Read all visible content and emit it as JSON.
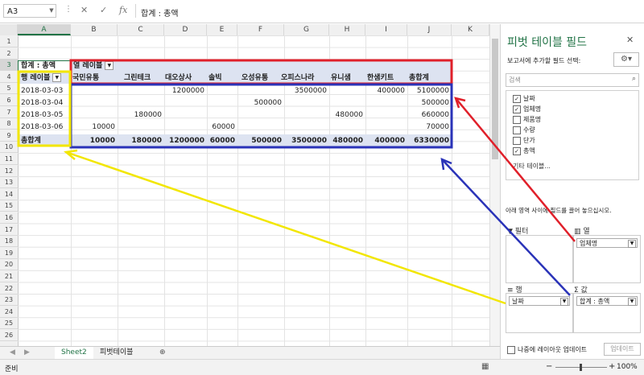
{
  "formula_bar": {
    "name_box": "A3",
    "formula": "합계 : 총액"
  },
  "columns": [
    "A",
    "B",
    "C",
    "D",
    "E",
    "F",
    "G",
    "H",
    "I",
    "J",
    "K"
  ],
  "rows": [
    "1",
    "2",
    "3",
    "4",
    "5",
    "6",
    "7",
    "8",
    "9",
    "10",
    "11",
    "12",
    "13",
    "14",
    "15",
    "16",
    "17",
    "18",
    "19",
    "20",
    "21",
    "22",
    "23",
    "24",
    "25",
    "26"
  ],
  "pivot": {
    "corner": "합계 : 총액",
    "col_label": "열 레이블",
    "row_label": "행 레이블",
    "headers": [
      "국민유통",
      "그린테크",
      "대오상사",
      "솔빅",
      "오성유통",
      "오피스나라",
      "유니샘",
      "한샘키트",
      "총합계"
    ],
    "dates": [
      "2018-03-03",
      "2018-03-04",
      "2018-03-05",
      "2018-03-06"
    ],
    "values": [
      [
        "",
        "",
        "1200000",
        "",
        "",
        "3500000",
        "",
        "400000",
        "5100000"
      ],
      [
        "",
        "",
        "",
        "",
        "500000",
        "",
        "",
        "",
        "500000"
      ],
      [
        "",
        "180000",
        "",
        "",
        "",
        "",
        "480000",
        "",
        "660000"
      ],
      [
        "10000",
        "",
        "",
        "60000",
        "",
        "",
        "",
        "",
        "70000"
      ]
    ],
    "total_label": "총합계",
    "totals": [
      "10000",
      "180000",
      "1200000",
      "60000",
      "500000",
      "3500000",
      "480000",
      "400000",
      "6330000"
    ]
  },
  "tabs": [
    "Sheet2",
    "피벗테이블"
  ],
  "status": {
    "ready": "준비",
    "zoom": "100%"
  },
  "pane": {
    "title": "피벗 테이블 필드",
    "choose_label": "보고서에 추가할 필드 선택:",
    "search_placeholder": "검색",
    "fields": [
      {
        "name": "날짜",
        "checked": true
      },
      {
        "name": "업체명",
        "checked": true
      },
      {
        "name": "제품명",
        "checked": false
      },
      {
        "name": "수량",
        "checked": false
      },
      {
        "name": "단가",
        "checked": false
      },
      {
        "name": "총액",
        "checked": true
      }
    ],
    "more_tables": "기타 테이블...",
    "drag_hint": "아래 영역 사이에 필드를 끌어 놓으십시오.",
    "zones": {
      "filter": "필터",
      "columns": "열",
      "rows": "행",
      "values": "Σ 값"
    },
    "columns_field": "업체명",
    "rows_field": "날짜",
    "values_field": "합계 : 총액",
    "defer_label": "나중에 레이아웃 업데이트",
    "update_button": "업데이트"
  },
  "annotation_colors": {
    "red": "#e0202a",
    "blue": "#2a33b8",
    "yellow": "#f2e600"
  }
}
